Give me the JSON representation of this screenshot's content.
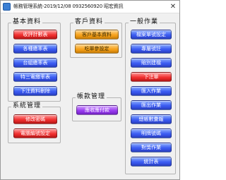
{
  "window": {
    "title": "帳務管理系統-2019/12/08  0932560920 昭宏資訊",
    "close_glyph": "✕"
  },
  "groups": {
    "basic": {
      "title": "基本資料",
      "buttons": [
        "收評計數表",
        "各種繳率表",
        "台組繳率表",
        "特三電繳率表",
        "下注資料刪除"
      ]
    },
    "customer": {
      "title": "客戶資料",
      "buttons": [
        "客戶基本資料",
        "吃單參設定"
      ]
    },
    "general": {
      "title": "一般作業",
      "buttons": [
        "檔案單號設定",
        "專屬號註",
        "賠別建檔",
        "下注單",
        "匯入作業",
        "匯出作業",
        "總帳數彙報",
        "明牌號碼",
        "對獎作業",
        "統計表"
      ]
    },
    "account": {
      "title": "帳款管理",
      "buttons": [
        "應收應付款"
      ]
    },
    "system": {
      "title": "系統管理",
      "buttons": [
        "修改密碼",
        "電腦編號設定"
      ]
    }
  },
  "colors": {
    "blue": "#3b5cf2",
    "red": "#f03030",
    "orange": "#f6a21c",
    "purple": "#9a3cf0",
    "panel": "#f0f0f0"
  }
}
